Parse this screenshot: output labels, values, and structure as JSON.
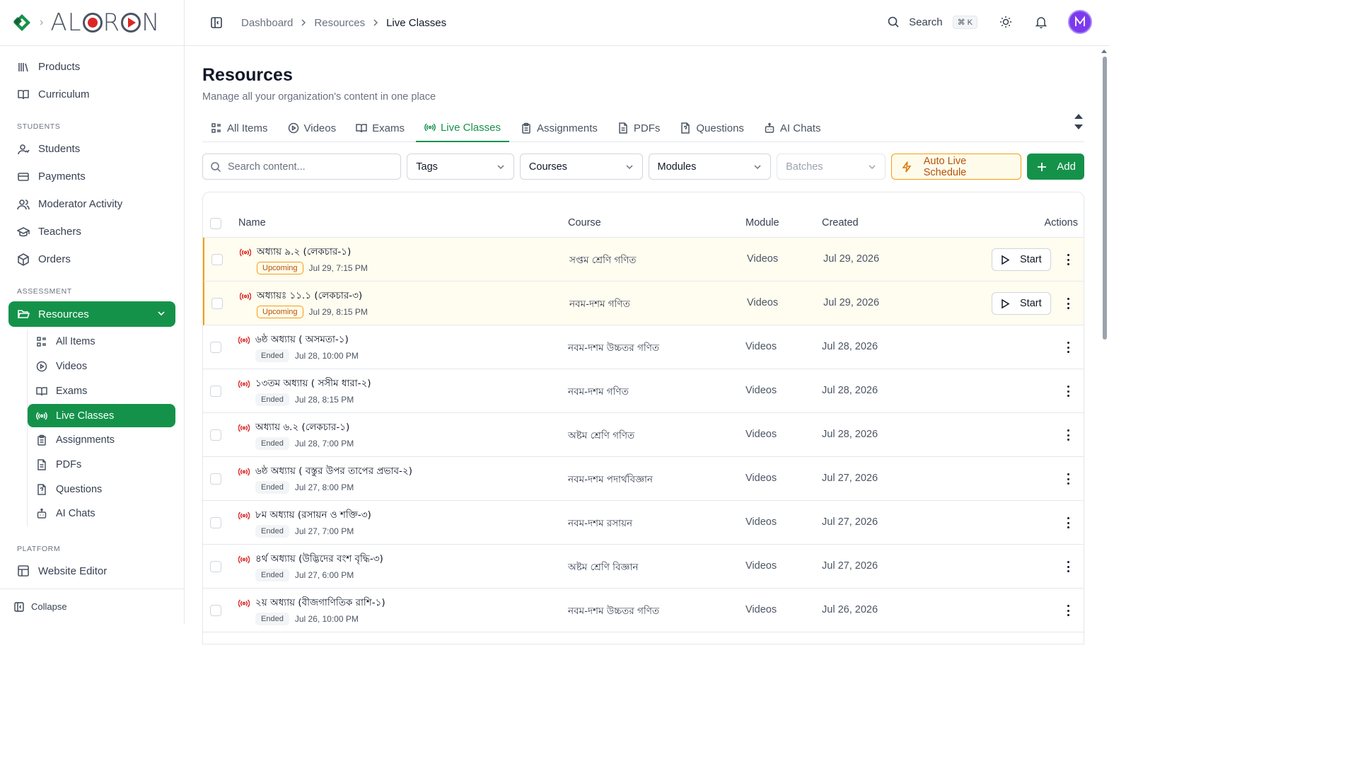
{
  "brand": {
    "name": "ALORON",
    "accent": "#15924a",
    "warning": "#f59e0b",
    "live_color": "#dc2626"
  },
  "header": {
    "breadcrumbs": [
      "Dashboard",
      "Resources",
      "Live Classes"
    ],
    "search_label": "Search",
    "search_kbd": "⌘ K"
  },
  "sidebar": {
    "top_items": [
      {
        "label": "Products",
        "icon": "library-icon"
      },
      {
        "label": "Curriculum",
        "icon": "book-open-icon"
      }
    ],
    "students_label": "STUDENTS",
    "students_items": [
      {
        "label": "Students",
        "icon": "user-icon"
      },
      {
        "label": "Payments",
        "icon": "credit-card-icon"
      },
      {
        "label": "Moderator Activity",
        "icon": "users-icon"
      },
      {
        "label": "Teachers",
        "icon": "graduation-cap-icon"
      },
      {
        "label": "Orders",
        "icon": "package-icon"
      }
    ],
    "assessment_label": "ASSESSMENT",
    "resources_label": "Resources",
    "resources_sub": [
      {
        "label": "All Items",
        "icon": "list-icon"
      },
      {
        "label": "Videos",
        "icon": "play-circle-icon"
      },
      {
        "label": "Exams",
        "icon": "book-open-icon"
      },
      {
        "label": "Live Classes",
        "icon": "radio-icon",
        "active": true
      },
      {
        "label": "Assignments",
        "icon": "clipboard-icon"
      },
      {
        "label": "PDFs",
        "icon": "file-text-icon"
      },
      {
        "label": "Questions",
        "icon": "file-question-icon"
      },
      {
        "label": "AI Chats",
        "icon": "bot-icon"
      }
    ],
    "platform_label": "PLATFORM",
    "platform_items": [
      {
        "label": "Website Editor",
        "icon": "layout-icon"
      }
    ],
    "collapse_label": "Collapse"
  },
  "page": {
    "title": "Resources",
    "subtitle": "Manage all your organization's content in one place"
  },
  "tabs": [
    {
      "label": "All Items",
      "icon": "list-icon"
    },
    {
      "label": "Videos",
      "icon": "play-circle-icon"
    },
    {
      "label": "Exams",
      "icon": "book-open-icon"
    },
    {
      "label": "Live Classes",
      "icon": "radio-icon",
      "active": true
    },
    {
      "label": "Assignments",
      "icon": "clipboard-icon"
    },
    {
      "label": "PDFs",
      "icon": "file-text-icon"
    },
    {
      "label": "Questions",
      "icon": "file-question-icon"
    },
    {
      "label": "AI Chats",
      "icon": "bot-icon"
    }
  ],
  "filters": {
    "search_placeholder": "Search content...",
    "tags": "Tags",
    "courses": "Courses",
    "modules": "Modules",
    "batches": "Batches",
    "auto_live": "Auto Live Schedule",
    "add": "Add"
  },
  "table": {
    "headers": {
      "name": "Name",
      "course": "Course",
      "module": "Module",
      "created": "Created",
      "actions": "Actions"
    },
    "start_label": "Start",
    "rows": [
      {
        "title": "অধ্যায় ৯.২ (লেকচার-১)",
        "status": "Upcoming",
        "time": "Jul 29, 7:15 PM",
        "course": "সপ্তম শ্রেণি গণিত",
        "module": "Videos",
        "created": "Jul 29, 2026",
        "upcoming": true
      },
      {
        "title": "অধ্যায়ঃ ১১.১ (লেকচার-৩)",
        "status": "Upcoming",
        "time": "Jul 29, 8:15 PM",
        "course": "নবম-দশম গণিত",
        "module": "Videos",
        "created": "Jul 29, 2026",
        "upcoming": true
      },
      {
        "title": "৬ষ্ঠ অধ্যায় ( অসমতা-১)",
        "status": "Ended",
        "time": "Jul 28, 10:00 PM",
        "course": "নবম-দশম উচ্চতর গণিত",
        "module": "Videos",
        "created": "Jul 28, 2026",
        "upcoming": false
      },
      {
        "title": "১৩তম অধ্যায় ( সসীম ধারা-২)",
        "status": "Ended",
        "time": "Jul 28, 8:15 PM",
        "course": "নবম-দশম গণিত",
        "module": "Videos",
        "created": "Jul 28, 2026",
        "upcoming": false
      },
      {
        "title": "অধ্যায় ৬.২ (লেকচার-১)",
        "status": "Ended",
        "time": "Jul 28, 7:00 PM",
        "course": "অষ্টম শ্রেণি গণিত",
        "module": "Videos",
        "created": "Jul 28, 2026",
        "upcoming": false
      },
      {
        "title": "৬ষ্ঠ অধ্যায় ( বস্তুর উপর তাপের প্রভাব-২)",
        "status": "Ended",
        "time": "Jul 27, 8:00 PM",
        "course": "নবম-দশম পদার্থবিজ্ঞান",
        "module": "Videos",
        "created": "Jul 27, 2026",
        "upcoming": false
      },
      {
        "title": "৮ম অধ্যায় (রসায়ন ও শক্তি-৩)",
        "status": "Ended",
        "time": "Jul 27, 7:00 PM",
        "course": "নবম-দশম রসায়ন",
        "module": "Videos",
        "created": "Jul 27, 2026",
        "upcoming": false
      },
      {
        "title": "৪র্থ অধ্যায় (উদ্ভিদের বংশ বৃদ্ধি-৩)",
        "status": "Ended",
        "time": "Jul 27, 6:00 PM",
        "course": "অষ্টম শ্রেণি বিজ্ঞান",
        "module": "Videos",
        "created": "Jul 27, 2026",
        "upcoming": false
      },
      {
        "title": "২য় অধ্যায় (বীজগাণিতিক রাশি-১)",
        "status": "Ended",
        "time": "Jul 26, 10:00 PM",
        "course": "নবম-দশম উচ্চতর গণিত",
        "module": "Videos",
        "created": "Jul 26, 2026",
        "upcoming": false
      }
    ]
  }
}
